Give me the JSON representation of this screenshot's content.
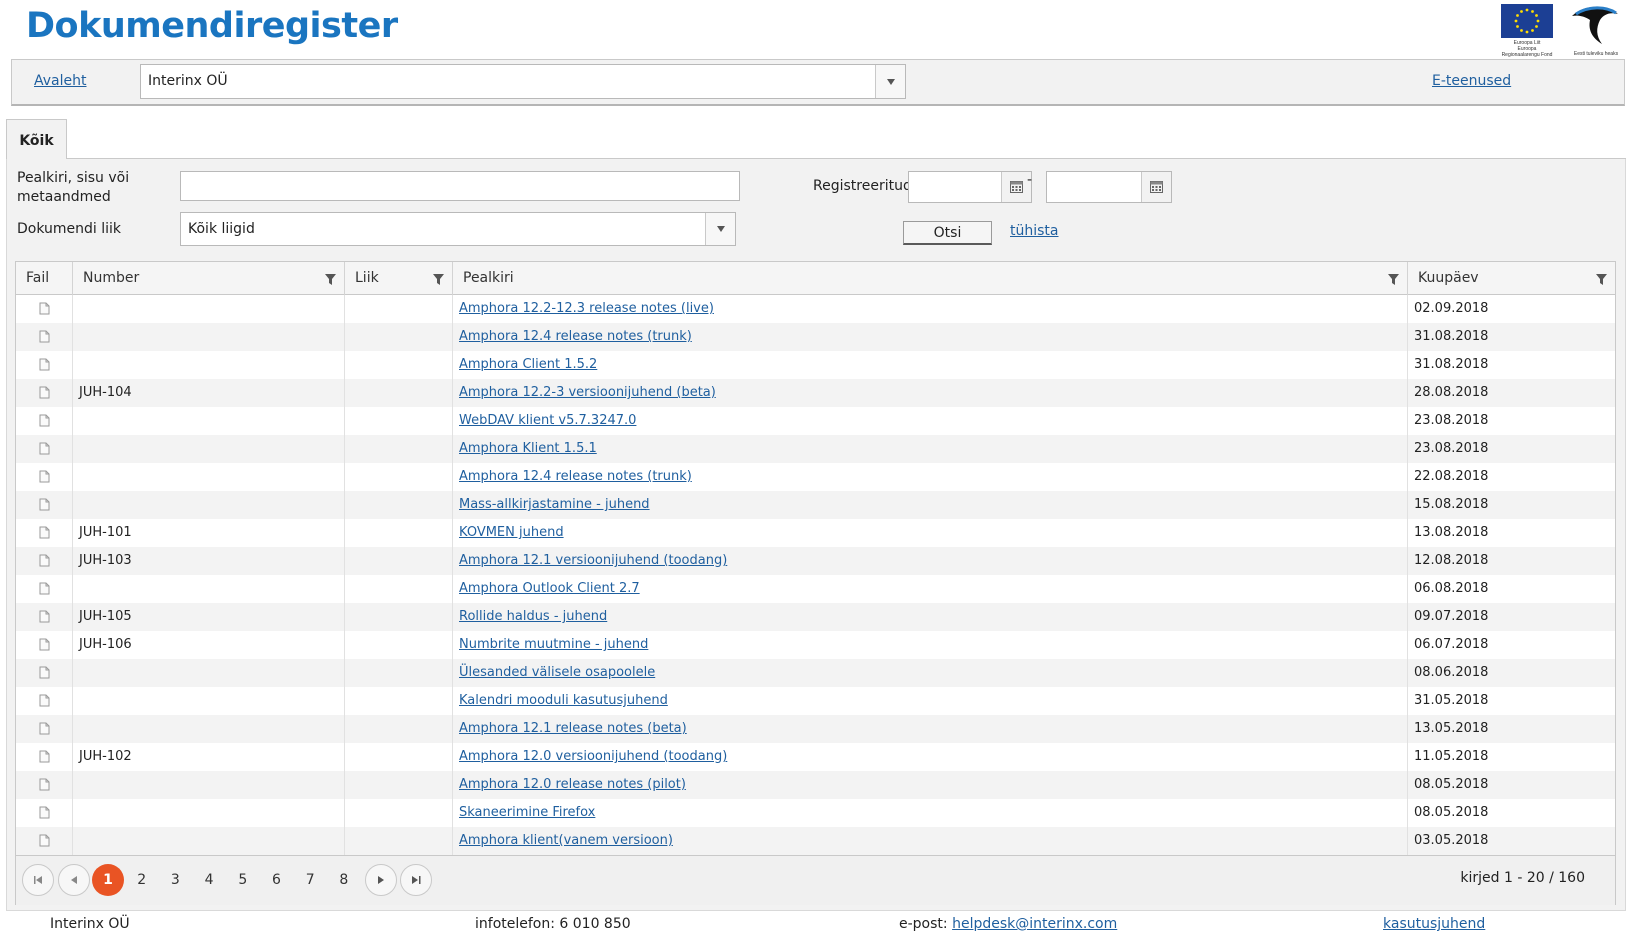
{
  "header": {
    "title": "Dokumendiregister",
    "eu_logo_caption": [
      "Euroopa Liit",
      "Euroopa",
      "Regionaalarengu Fond"
    ],
    "ee_logo_caption": "Eesti tuleviku heaks"
  },
  "nav": {
    "home_label": "Avaleht",
    "org_select_value": "Interinx OÜ",
    "eservices_label": "E-teenused"
  },
  "tabs": [
    {
      "label": "Kõik",
      "active": true
    }
  ],
  "search": {
    "query_label_line1": "Pealkiri, sisu või",
    "query_label_line2": "metaandmed",
    "query_value": "",
    "doctype_label": "Dokumendi liik",
    "doctype_value": "Kõik liigid",
    "registered_label": "Registreeritud",
    "date_from": "",
    "date_to": "",
    "date_separator": "-",
    "search_button": "Otsi",
    "clear_link": "tühista"
  },
  "grid": {
    "columns": [
      "Fail",
      "Number",
      "Liik",
      "Pealkiri",
      "Kuupäev"
    ],
    "rows": [
      {
        "number": "",
        "type": "",
        "title": "Amphora 12.2-12.3 release notes (live)",
        "date": "02.09.2018"
      },
      {
        "number": "",
        "type": "",
        "title": "Amphora 12.4 release notes (trunk)",
        "date": "31.08.2018"
      },
      {
        "number": "",
        "type": "",
        "title": "Amphora Client 1.5.2",
        "date": "31.08.2018"
      },
      {
        "number": "JUH-104",
        "type": "",
        "title": "Amphora 12.2-3 versioonijuhend (beta)",
        "date": "28.08.2018"
      },
      {
        "number": "",
        "type": "",
        "title": "WebDAV klient v5.7.3247.0",
        "date": "23.08.2018"
      },
      {
        "number": "",
        "type": "",
        "title": "Amphora Klient 1.5.1",
        "date": "23.08.2018"
      },
      {
        "number": "",
        "type": "",
        "title": "Amphora 12.4 release notes (trunk)",
        "date": "22.08.2018"
      },
      {
        "number": "",
        "type": "",
        "title": "Mass-allkirjastamine - juhend",
        "date": "15.08.2018"
      },
      {
        "number": "JUH-101",
        "type": "",
        "title": "KOVMEN juhend",
        "date": "13.08.2018"
      },
      {
        "number": "JUH-103",
        "type": "",
        "title": "Amphora 12.1 versioonijuhend (toodang)",
        "date": "12.08.2018"
      },
      {
        "number": "",
        "type": "",
        "title": "Amphora Outlook Client 2.7",
        "date": "06.08.2018"
      },
      {
        "number": "JUH-105",
        "type": "",
        "title": "Rollide haldus - juhend",
        "date": "09.07.2018"
      },
      {
        "number": "JUH-106",
        "type": "",
        "title": "Numbrite muutmine - juhend",
        "date": "06.07.2018"
      },
      {
        "number": "",
        "type": "",
        "title": "Ülesanded välisele osapoolele",
        "date": "08.06.2018"
      },
      {
        "number": "",
        "type": "",
        "title": "Kalendri mooduli kasutusjuhend",
        "date": "31.05.2018"
      },
      {
        "number": "",
        "type": "",
        "title": "Amphora 12.1 release notes (beta)",
        "date": "13.05.2018"
      },
      {
        "number": "JUH-102",
        "type": "",
        "title": "Amphora 12.0 versioonijuhend (toodang)",
        "date": "11.05.2018"
      },
      {
        "number": "",
        "type": "",
        "title": "Amphora 12.0 release notes (pilot)",
        "date": "08.05.2018"
      },
      {
        "number": "",
        "type": "",
        "title": "Skaneerimine Firefox",
        "date": "08.05.2018"
      },
      {
        "number": "",
        "type": "",
        "title": "Amphora klient(vanem versioon)",
        "date": "03.05.2018"
      }
    ]
  },
  "pager": {
    "pages": [
      "1",
      "2",
      "3",
      "4",
      "5",
      "6",
      "7",
      "8"
    ],
    "current": "1",
    "info": "kirjed 1 - 20 / 160"
  },
  "footer": {
    "org": "Interinx OÜ",
    "phone": "infotelefon: 6 010 850",
    "email_label": "e-post:",
    "email": "helpdesk@interinx.com",
    "manual": "kasutusjuhend"
  },
  "colors": {
    "title": "#1a75c0",
    "link": "#1f5f9f",
    "active_page": "#e95424",
    "eu_flag": "#1c3f94"
  }
}
